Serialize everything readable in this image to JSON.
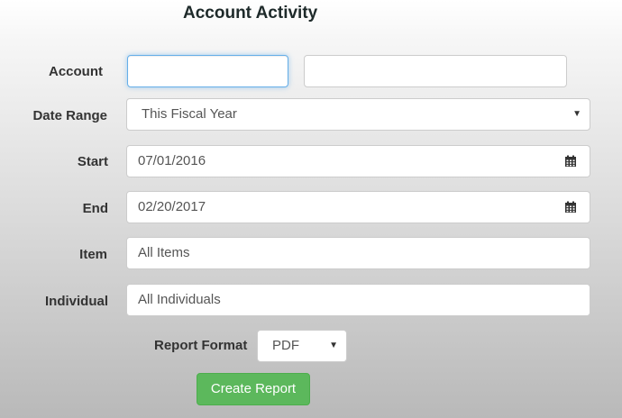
{
  "page": {
    "title": "Account Activity"
  },
  "form": {
    "account": {
      "label": "Account",
      "value": "",
      "secondary_value": ""
    },
    "date_range": {
      "label": "Date Range",
      "selected": "This Fiscal Year"
    },
    "start": {
      "label": "Start",
      "value": "07/01/2016"
    },
    "end": {
      "label": "End",
      "value": "02/20/2017"
    },
    "item": {
      "label": "Item",
      "value": "All Items"
    },
    "individual": {
      "label": "Individual",
      "value": "All Individuals"
    },
    "report_format": {
      "label": "Report Format",
      "selected": "PDF"
    },
    "create_button": {
      "label": "Create Report"
    }
  },
  "colors": {
    "button": "#5cb85c",
    "focus_border": "#66afe9"
  },
  "icons": {
    "calendar": "calendar-icon",
    "dropdown": "chevron-down-icon"
  }
}
